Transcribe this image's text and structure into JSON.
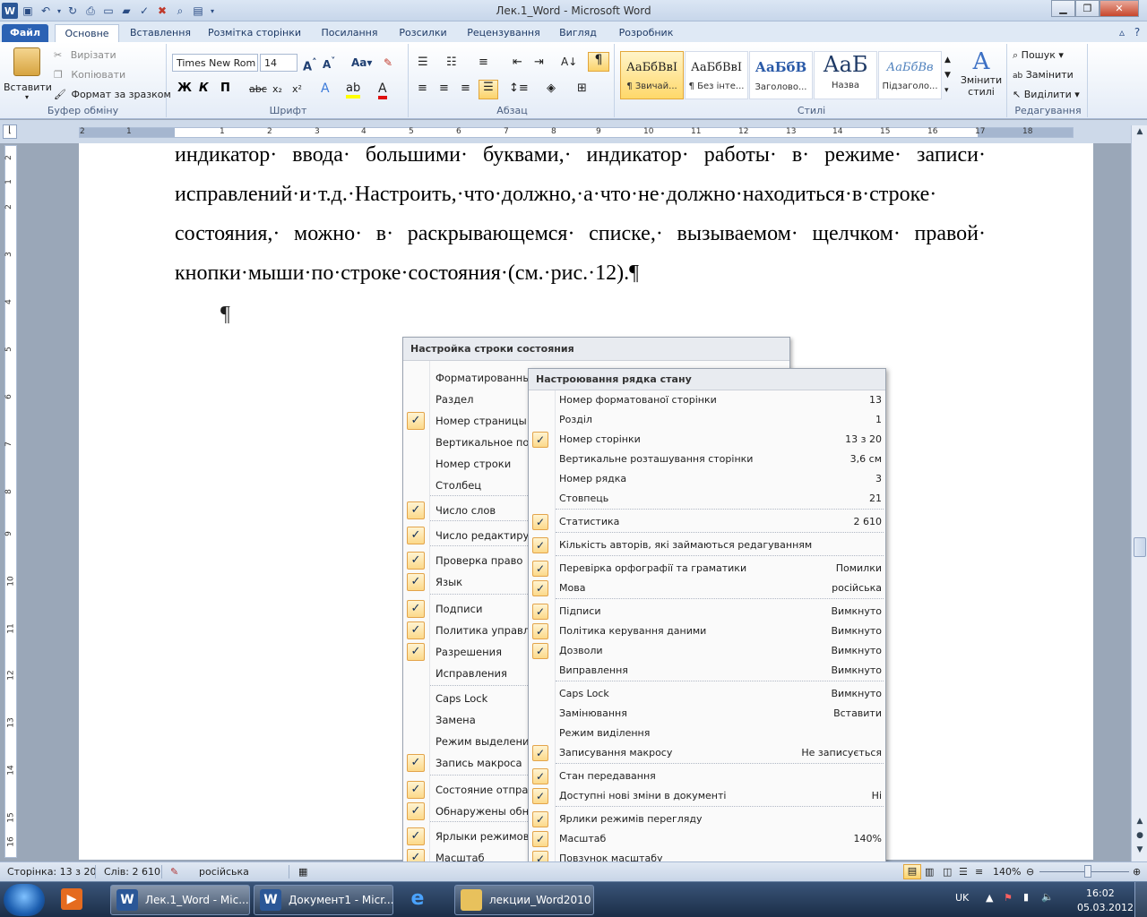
{
  "window": {
    "title": "Лек.1_Word - Microsoft Word"
  },
  "tabs": [
    {
      "label": "Файл"
    },
    {
      "label": "Основне"
    },
    {
      "label": "Вставлення"
    },
    {
      "label": "Розмітка сторінки"
    },
    {
      "label": "Посилання"
    },
    {
      "label": "Розсилки"
    },
    {
      "label": "Рецензування"
    },
    {
      "label": "Вигляд"
    },
    {
      "label": "Розробник"
    }
  ],
  "ribbon": {
    "clipboard": {
      "paste": "Вставити",
      "cut": "Вирізати",
      "copy": "Копіювати",
      "format_painter": "Формат за зразком",
      "label": "Буфер обміну"
    },
    "font": {
      "name": "Times New Rom",
      "size": "14",
      "label": "Шрифт"
    },
    "paragraph": {
      "label": "Абзац"
    },
    "styles": {
      "items": [
        {
          "sample": "АаБбВвІ",
          "name": "¶ Звичай..."
        },
        {
          "sample": "АаБбВвІ",
          "name": "¶ Без інте..."
        },
        {
          "sample": "АаБбВ",
          "name": "Заголово..."
        },
        {
          "sample": "АаБ",
          "name": "Назва"
        },
        {
          "sample": "АаБбВв",
          "name": "Підзаголо..."
        }
      ],
      "change_styles": "Змінити стилі",
      "label": "Стилі"
    },
    "editing": {
      "find": "Пошук",
      "replace": "Замінити",
      "select": "Виділити",
      "label": "Редагування"
    }
  },
  "ruler": {
    "h_numbers": [
      "2",
      "1",
      "1",
      "2",
      "3",
      "4",
      "5",
      "6",
      "7",
      "8",
      "9",
      "10",
      "11",
      "12",
      "13",
      "14",
      "15",
      "16",
      "17",
      "18"
    ],
    "v_numbers": [
      "2",
      "1",
      "2",
      "3",
      "4",
      "5",
      "6",
      "7",
      "8",
      "9",
      "10",
      "11",
      "12",
      "13",
      "14",
      "15",
      "16",
      "17"
    ]
  },
  "document": {
    "lines": [
      "индикатор· ввода· большими· буквами,· индикатор· работы· в· режиме· записи·",
      "исправлений·и·т.д.·Настроить,·что·должно,·а·что·не·должно·находиться·в·строке·",
      "состояния,· можно· в· раскрывающемся· списке,· вызываемом· щелчком· правой·",
      "кнопки·мыши·по·строке·состояния·(см.·рис.·12).¶"
    ],
    "empty_paragraph": "¶"
  },
  "menu_ru": {
    "title": "Настройка строки состояния",
    "items": [
      {
        "label": "Форматированный",
        "checked": false
      },
      {
        "label": "Раздел",
        "checked": false
      },
      {
        "label": "Номер страницы",
        "checked": true
      },
      {
        "label": "Вертикальное по",
        "checked": false
      },
      {
        "label": "Номер строки",
        "checked": false
      },
      {
        "label": "Столбец",
        "checked": false
      },
      {
        "label": "Число слов",
        "checked": true
      },
      {
        "label": "Число редактиру",
        "checked": true
      },
      {
        "label": "Проверка право",
        "checked": true
      },
      {
        "label": "Язык",
        "checked": true
      },
      {
        "label": "Подписи",
        "checked": true
      },
      {
        "label": "Политика управл",
        "checked": true
      },
      {
        "label": "Разрешения",
        "checked": true
      },
      {
        "label": "Исправления",
        "checked": false
      },
      {
        "label": "Caps Lock",
        "checked": false
      },
      {
        "label": "Замена",
        "checked": false
      },
      {
        "label": "Режим выделени",
        "checked": false
      },
      {
        "label": "Запись макроса",
        "checked": true
      },
      {
        "label": "Состояние отпра",
        "checked": true
      },
      {
        "label": "Обнаружены обн",
        "checked": true
      },
      {
        "label": "Ярлыки режимов",
        "checked": true
      },
      {
        "label": "Масштаб",
        "checked": true
      }
    ]
  },
  "menu_ua": {
    "title": "Настроювання рядка стану",
    "items": [
      {
        "label": "Номер форматованої сторінки",
        "value": "13",
        "checked": false
      },
      {
        "label": "Розділ",
        "value": "1",
        "checked": false
      },
      {
        "label": "Номер сторінки",
        "value": "13 з 20",
        "checked": true
      },
      {
        "label": "Вертикальне розташування сторінки",
        "value": "3,6 см",
        "checked": false
      },
      {
        "label": "Номер рядка",
        "value": "3",
        "checked": false
      },
      {
        "label": "Стовпець",
        "value": "21",
        "checked": false
      },
      {
        "label": "Статистика",
        "value": "2 610",
        "checked": true
      },
      {
        "label": "Кількість авторів, які займаються редагуванням",
        "value": "",
        "checked": true
      },
      {
        "label": "Перевірка орфографії та граматики",
        "value": "Помилки",
        "checked": true
      },
      {
        "label": "Мова",
        "value": "російська",
        "checked": true
      },
      {
        "label": "Підписи",
        "value": "Вимкнуто",
        "checked": true
      },
      {
        "label": "Політика керування даними",
        "value": "Вимкнуто",
        "checked": true
      },
      {
        "label": "Дозволи",
        "value": "Вимкнуто",
        "checked": true
      },
      {
        "label": "Виправлення",
        "value": "Вимкнуто",
        "checked": false
      },
      {
        "label": "Caps Lock",
        "value": "Вимкнуто",
        "checked": false
      },
      {
        "label": "Замінювання",
        "value": "Вставити",
        "checked": false
      },
      {
        "label": "Режим виділення",
        "value": "",
        "checked": false
      },
      {
        "label": "Записування макросу",
        "value": "Не записується",
        "checked": true
      },
      {
        "label": "Стан передавання",
        "value": "",
        "checked": true
      },
      {
        "label": "Доступні нові зміни в документі",
        "value": "Ні",
        "checked": true
      },
      {
        "label": "Ярлики режимів перегляду",
        "value": "",
        "checked": true
      },
      {
        "label": "Масштаб",
        "value": "140%",
        "checked": true
      },
      {
        "label": "Повзунок масштабу",
        "value": "",
        "checked": true
      }
    ]
  },
  "statusbar": {
    "page": "Сторінка: 13 з 20",
    "words": "Слів: 2 610",
    "language": "російська",
    "zoom": "140%"
  },
  "taskbar": {
    "items": [
      {
        "label": "Лек.1_Word - Mic..."
      },
      {
        "label": "Документ1 - Micr..."
      },
      {
        "label": "лекции_Word2010"
      }
    ],
    "lang": "UK",
    "time": "16:02",
    "date": "05.03.2012"
  },
  "colors": {
    "accent": "#2b62b4",
    "check_bg": "#fcd98a",
    "check_border": "#e3a44a"
  }
}
